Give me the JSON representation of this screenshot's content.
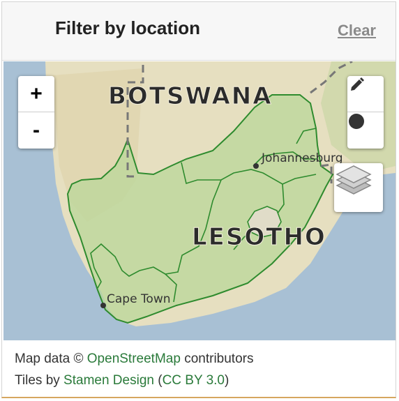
{
  "header": {
    "title": "Filter by location",
    "clear_label": "Clear"
  },
  "map": {
    "labels": {
      "botswana": "BOTSWANA",
      "lesotho": "LESOTHO",
      "johannesburg": "Johannesburg",
      "cape_town": "Cape Town"
    },
    "controls": {
      "zoom_in": "+",
      "zoom_out": "-"
    },
    "colors": {
      "ocean": "#a8c0d4",
      "land": "#e9e4c8",
      "selection_fill": "#b9d79a",
      "selection_stroke": "#2e8b2e"
    }
  },
  "attribution": {
    "line1_prefix": "Map data © ",
    "line1_link": "OpenStreetMap",
    "line1_suffix": " contributors",
    "line2_prefix": "Tiles by ",
    "line2_link": "Stamen Design",
    "line2_mid": " (",
    "line2_link2": "CC BY 3.0",
    "line2_suffix": ")"
  }
}
